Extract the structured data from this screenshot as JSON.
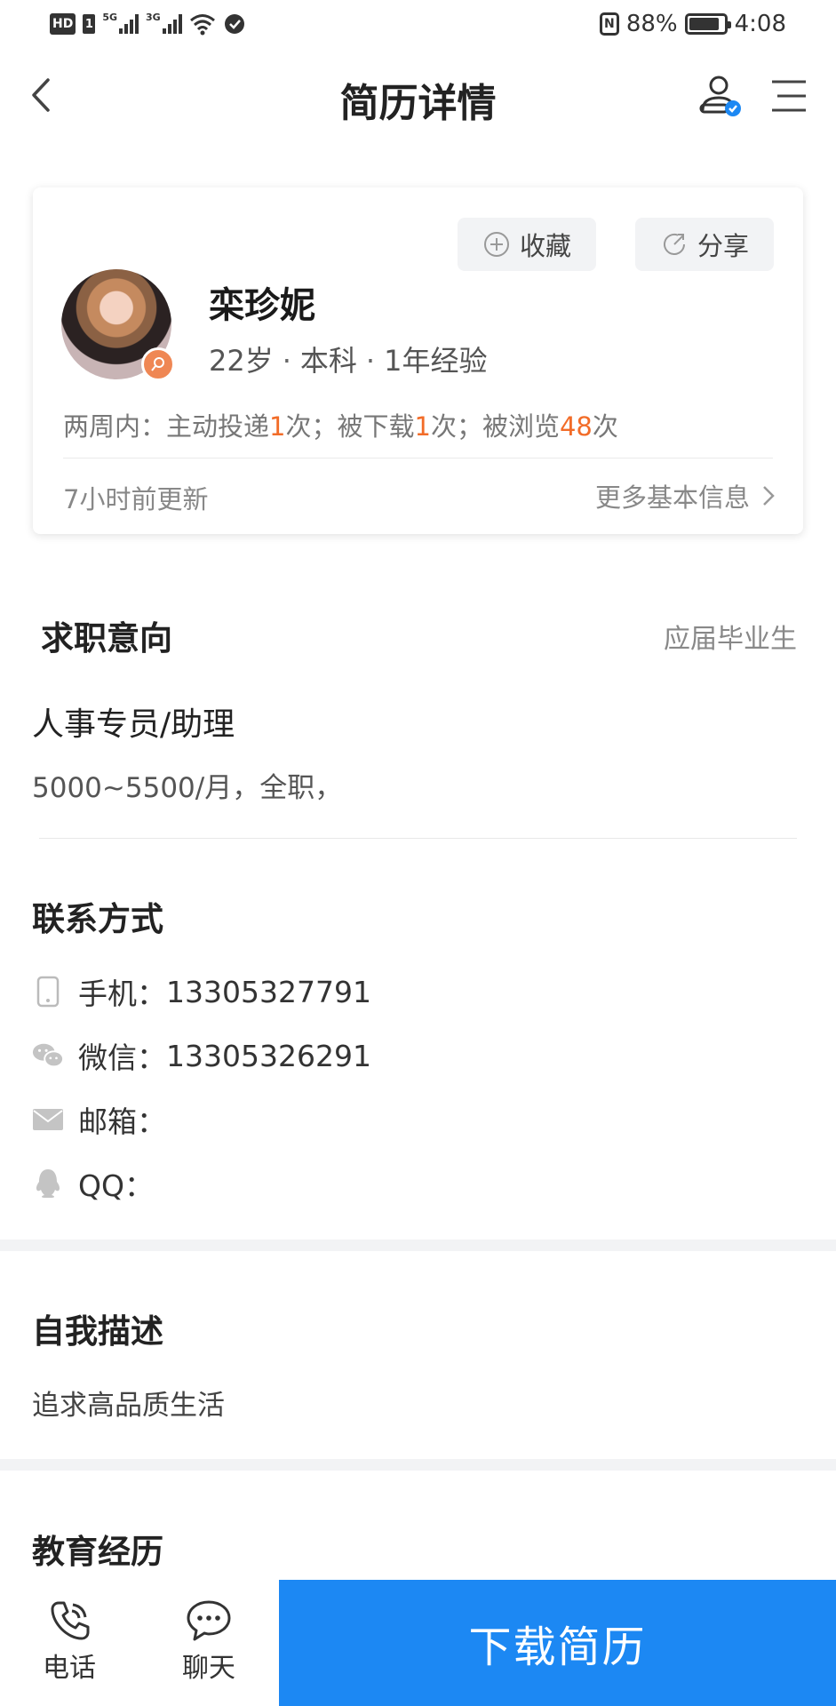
{
  "status_bar": {
    "hd_label": "HD",
    "sim1": "1",
    "net1": "5G",
    "net2": "3G",
    "nfc": "N",
    "battery": "88%",
    "battery_level": 0.88,
    "time": "4:08"
  },
  "nav": {
    "title": "简历详情"
  },
  "profile": {
    "collect_label": "收藏",
    "share_label": "分享",
    "name": "栾珍妮",
    "age": "22岁",
    "education": "本科",
    "experience": "1年经验",
    "stats_prefix": "两周内：主动投递",
    "apply_count": "1",
    "stats_mid1": "次；被下载",
    "download_count": "1",
    "stats_mid2": "次；被浏览",
    "view_count": "48",
    "stats_suffix": "次",
    "updated": "7小时前更新",
    "more_info": "更多基本信息",
    "accent_color": "#f26c28"
  },
  "intention": {
    "title": "求职意向",
    "status": "应届毕业生",
    "position": "人事专员/助理",
    "detail": "5000~5500/月，全职，"
  },
  "contact": {
    "title": "联系方式",
    "items": [
      {
        "icon": "phone-icon",
        "label": "手机：",
        "value": "13305327791"
      },
      {
        "icon": "wechat-icon",
        "label": "微信：",
        "value": "13305326291"
      },
      {
        "icon": "mail-icon",
        "label": "邮箱：",
        "value": ""
      },
      {
        "icon": "qq-icon",
        "label": "QQ：",
        "value": ""
      }
    ]
  },
  "self_description": {
    "title": "自我描述",
    "text": "追求高品质生活"
  },
  "education": {
    "title": "教育经历"
  },
  "bottom_bar": {
    "call_label": "电话",
    "chat_label": "聊天",
    "download_label": "下载简历",
    "button_color": "#1c88f3"
  }
}
